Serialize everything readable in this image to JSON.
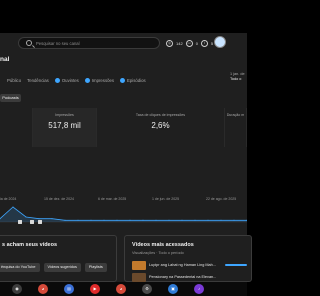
{
  "search": {
    "placeholder": "Pesquisar no seu canal"
  },
  "header_icons": {
    "count": "142",
    "cc": "0",
    "info": "5"
  },
  "channel": {
    "title_partial": "nal"
  },
  "tabs": [
    {
      "label": "Público"
    },
    {
      "label": "Tendências"
    },
    {
      "label": "Ouvintes"
    },
    {
      "label": "Impressões"
    },
    {
      "label": "Episódios"
    }
  ],
  "filter_pill": {
    "label": "Podcasts"
  },
  "date_range": {
    "line1": "1 jan. de",
    "line2": "Todo o"
  },
  "metrics": [
    {
      "label": "",
      "value": ""
    },
    {
      "label": "Impressões",
      "value": "517,8 mil"
    },
    {
      "label": "Taxa de cliques de impressões",
      "value": "2,6%"
    },
    {
      "label": "Duração m",
      "value": ""
    }
  ],
  "chart_data": {
    "type": "area",
    "x": [
      "ia de 2024",
      "15 de dez. de 2024",
      "6 de mar. de 2025",
      "1 de jun. de 2025",
      "22 de ago. de 2025"
    ],
    "values": [
      2,
      9,
      3,
      2,
      2,
      1,
      1,
      1,
      1,
      1,
      1,
      1,
      1,
      1,
      1,
      1,
      1,
      1,
      1,
      1
    ],
    "color": "#3ea6ff"
  },
  "discovery_card": {
    "title_partial": "s acham seus vídeos",
    "chips": [
      "ênquisa do YouTube",
      "Vídeos sugeridos",
      "Playlists"
    ]
  },
  "top_videos_card": {
    "title": "Vídeos mais acessados",
    "subtitle": "Visualizações · Todo o período",
    "videos": [
      {
        "title": "Lupipr ang Lahat ng Haman Ling Mah..."
      },
      {
        "title": "Pensionary na Passedental na Elevan..."
      }
    ]
  },
  "taskbar": {
    "icons": [
      "camera-icon",
      "chrome-icon",
      "files-icon",
      "youtube-icon",
      "chrome-icon",
      "settings-icon",
      "folder-icon",
      "media-icon"
    ]
  }
}
